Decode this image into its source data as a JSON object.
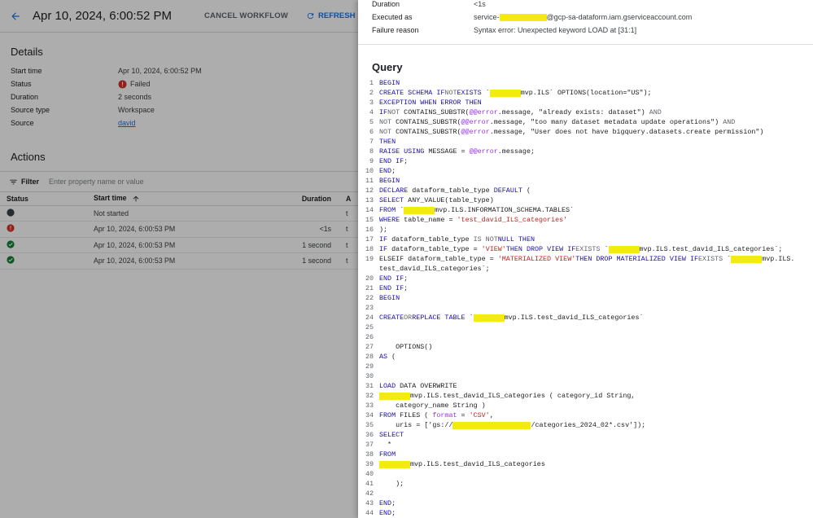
{
  "header": {
    "title": "Apr 10, 2024, 6:00:52 PM",
    "cancel_label": "CANCEL WORKFLOW",
    "refresh_label": "REFRESH"
  },
  "details": {
    "heading": "Details",
    "rows": [
      {
        "key": "Start time",
        "value": "Apr 10, 2024, 6:00:52 PM"
      },
      {
        "key": "Status",
        "value": "Failed"
      },
      {
        "key": "Duration",
        "value": "2 seconds"
      },
      {
        "key": "Source type",
        "value": "Workspace"
      },
      {
        "key": "Source",
        "value": "david"
      }
    ]
  },
  "actions": {
    "heading": "Actions",
    "filter_label": "Filter",
    "filter_placeholder": "Enter property name or value",
    "columns": [
      "Status",
      "Start time",
      "Duration",
      "A"
    ],
    "rows": [
      {
        "status": "not-started",
        "start": "Not started",
        "duration": "",
        "extra": "t"
      },
      {
        "status": "failed",
        "start": "Apr 10, 2024, 6:00:53 PM",
        "duration": "<1s",
        "extra": "t"
      },
      {
        "status": "succeeded",
        "start": "Apr 10, 2024, 6:00:53 PM",
        "duration": "1 second",
        "extra": "t"
      },
      {
        "status": "succeeded",
        "start": "Apr 10, 2024, 6:00:53 PM",
        "duration": "1 second",
        "extra": "t"
      }
    ]
  },
  "panel": {
    "duration_key": "Duration",
    "duration_value": "<1s",
    "executed_key": "Executed as",
    "executed_prefix": "service-",
    "executed_suffix": "@gcp-sa-dataform.iam.gserviceaccount.com",
    "failure_key": "Failure reason",
    "failure_value": "Syntax error: Unexpected keyword LOAD at [31:1]",
    "query_title": "Query"
  },
  "colors": {
    "accent": "#1a73e8",
    "error": "#d93025",
    "success": "#188038",
    "highlight": "#f2ea10"
  }
}
